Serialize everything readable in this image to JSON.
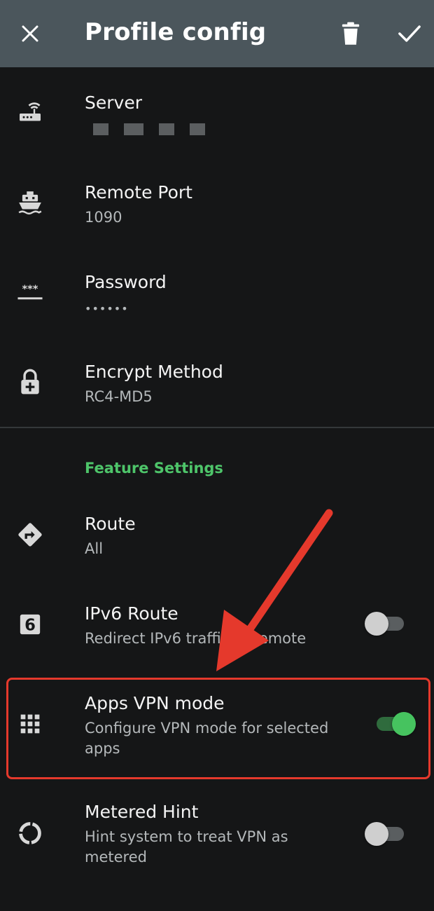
{
  "toolbar": {
    "title": "Profile config",
    "close_icon": "close-icon",
    "delete_icon": "trash-icon",
    "save_icon": "check-icon",
    "background": "#4b565c"
  },
  "profile": {
    "server": {
      "title": "Server",
      "icon": "router-icon"
    },
    "remote_port": {
      "title": "Remote Port",
      "value": "1090",
      "icon": "ship-icon"
    },
    "password": {
      "title": "Password",
      "value": "••••••",
      "icon": "password-icon"
    },
    "encrypt_method": {
      "title": "Encrypt Method",
      "value": "RC4-MD5",
      "icon": "lock-icon"
    }
  },
  "feature_settings": {
    "header": "Feature Settings",
    "header_color": "#4ec56a",
    "route": {
      "title": "Route",
      "value": "All",
      "icon": "directions-icon"
    },
    "ipv6_route": {
      "title": "IPv6 Route",
      "summary": "Redirect IPv6 traffic to remote",
      "icon": "ipv6-icon",
      "enabled": false
    },
    "apps_vpn_mode": {
      "title": "Apps VPN mode",
      "summary": "Configure VPN mode for selected apps",
      "icon": "apps-grid-icon",
      "enabled": true
    },
    "metered_hint": {
      "title": "Metered Hint",
      "summary": "Hint system to treat VPN as metered",
      "icon": "metered-icon",
      "enabled": false
    }
  },
  "annotation": {
    "highlight_color": "#e5392c"
  }
}
